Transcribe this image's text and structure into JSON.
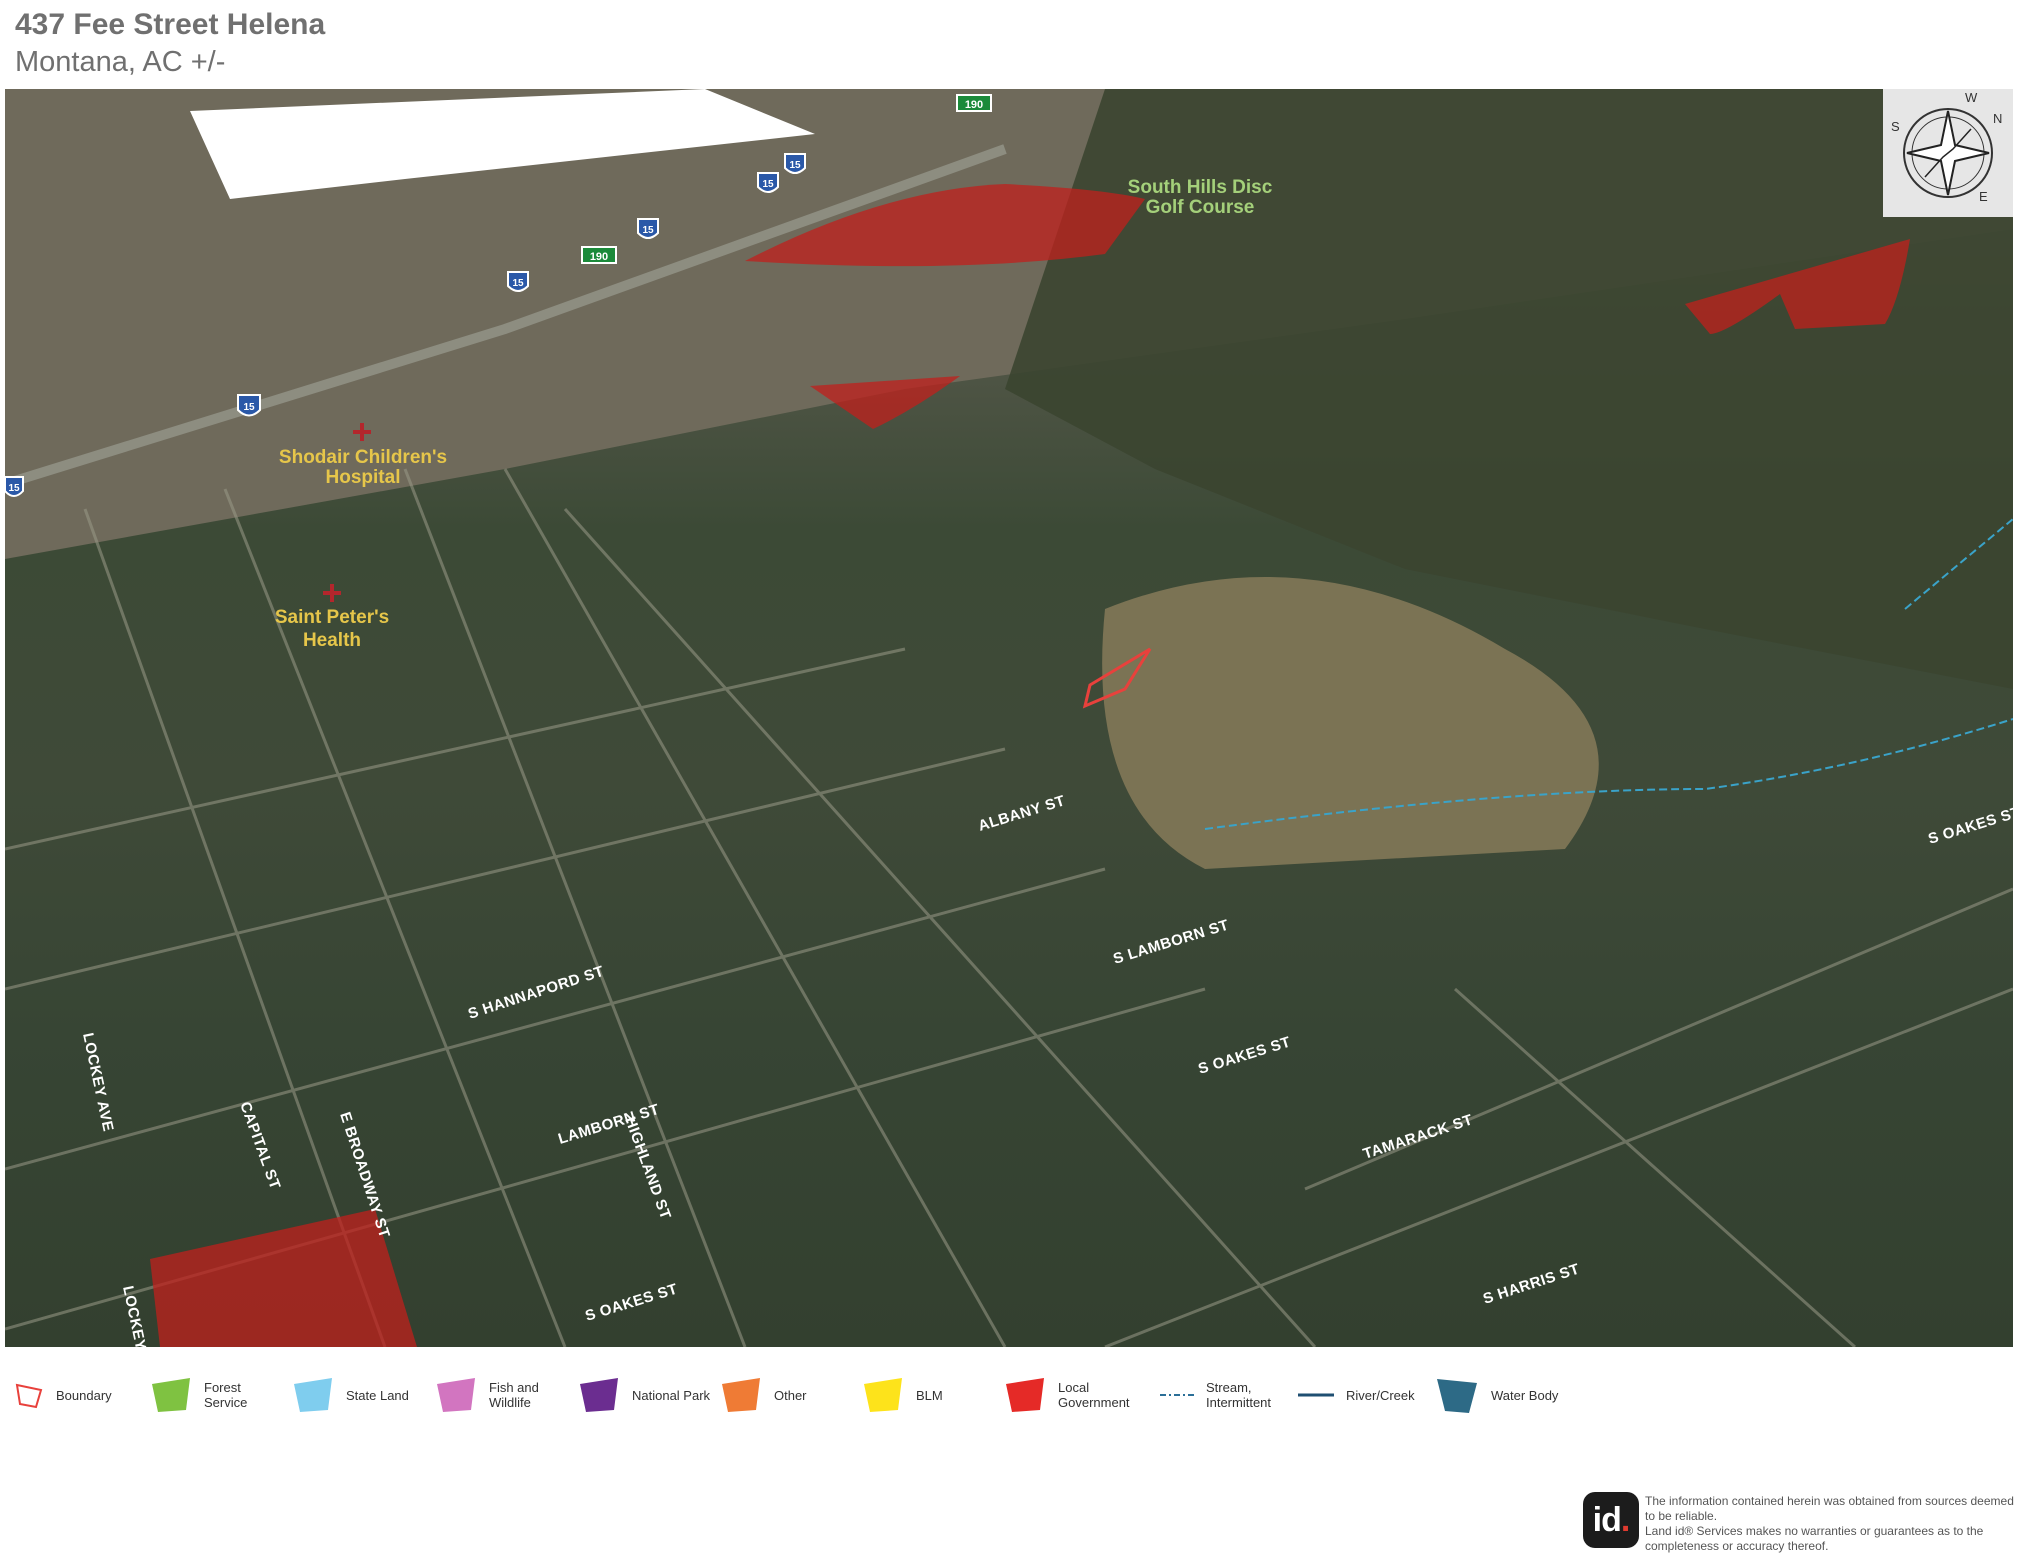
{
  "header": {
    "title": "437 Fee Street Helena",
    "subtitle": "Montana,  AC +/-"
  },
  "map": {
    "poi": [
      {
        "name": "Shodair Children's",
        "line2": "Hospital"
      },
      {
        "name": "Saint Peter's",
        "line2": "Health"
      },
      {
        "name": "South Hills Disc",
        "line2": "Golf Course"
      }
    ],
    "highway_shields": [
      "15",
      "15",
      "15",
      "15",
      "15",
      "15"
    ],
    "route_shields": [
      "190",
      "190"
    ],
    "streets": [
      "S HANNAPORD ST",
      "LAMBORN ST",
      "S OAKES ST",
      "S OAKES ST",
      "TAMARACK ST",
      "S HARRIS ST",
      "S LAMBORN ST",
      "HIGHLAND ST",
      "CAPITAL ST",
      "E BROADWAY ST",
      "LOCKEY AVE",
      "ALBANY ST",
      "S OAKES ST",
      "LOCKEY AV"
    ],
    "compass": {
      "letters": [
        "N",
        "E",
        "S",
        "W"
      ]
    },
    "colors": {
      "local_government": "#c0201c",
      "boundary": "#e8413c",
      "stream": "#3aa3c9"
    }
  },
  "legend": [
    {
      "label": "Boundary",
      "color": "#e8413c",
      "kind": "outline"
    },
    {
      "label": "Forest\nService",
      "color": "#7fc241",
      "kind": "fill"
    },
    {
      "label": "State Land",
      "color": "#7fcdee",
      "kind": "fill"
    },
    {
      "label": "Fish and\nWildlife",
      "color": "#d275c0",
      "kind": "fill"
    },
    {
      "label": "National Park",
      "color": "#6b2d90",
      "kind": "fill"
    },
    {
      "label": "Other",
      "color": "#ef7b35",
      "kind": "fill"
    },
    {
      "label": "BLM",
      "color": "#fde31b",
      "kind": "fill"
    },
    {
      "label": "Local\nGovernment",
      "color": "#e52a27",
      "kind": "fill"
    },
    {
      "label": "Stream,\nIntermittent",
      "color": "#2b6f98",
      "kind": "dash"
    },
    {
      "label": "River/Creek",
      "color": "#1f4f72",
      "kind": "line"
    },
    {
      "label": "Water Body",
      "color": "#2d6a86",
      "kind": "fill"
    }
  ],
  "footer": {
    "logo": "id",
    "disclaimer": "The information contained herein was obtained from sources deemed to be reliable.\n Land id® Services makes no warranties or guarantees as to the completeness or accuracy thereof."
  }
}
